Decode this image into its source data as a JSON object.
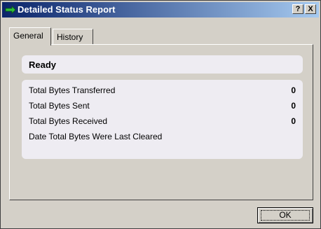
{
  "window": {
    "title": "Detailed Status Report",
    "help_label": "?",
    "close_label": "X"
  },
  "tabs": [
    {
      "label": "General",
      "selected": true
    },
    {
      "label": "History",
      "selected": false
    }
  ],
  "status": {
    "text": "Ready"
  },
  "stats": [
    {
      "label": "Total Bytes Transferred",
      "value": "0"
    },
    {
      "label": "Total Bytes Sent",
      "value": "0"
    },
    {
      "label": "Total Bytes Received",
      "value": "0"
    },
    {
      "label": "Date Total Bytes Were Last Cleared",
      "value": ""
    }
  ],
  "buttons": {
    "ok_label": "OK"
  },
  "colors": {
    "titlebar_start": "#0a246a",
    "titlebar_end": "#a6caf0",
    "icon_green": "#2fbf3a",
    "dialog_bg": "#d4d0c8"
  },
  "icons": {
    "app_icon": "green-arrow-icon"
  }
}
